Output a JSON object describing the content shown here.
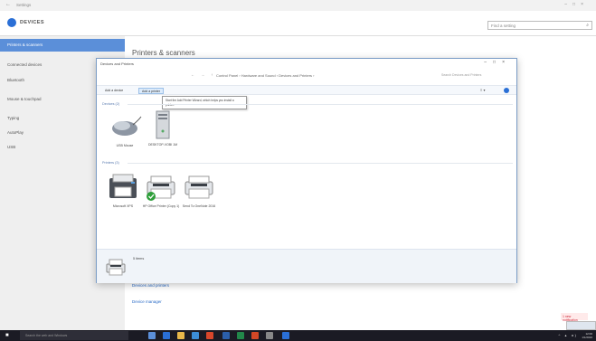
{
  "settings": {
    "window_title": "Settings",
    "window_controls": [
      "–",
      "□",
      "×"
    ],
    "header_title": "DEVICES",
    "search_placeholder": "Find a setting",
    "nav_items": [
      {
        "label": "Printers & scanners",
        "active": true
      },
      {
        "label": "Connected devices"
      },
      {
        "label": "Bluetooth"
      },
      {
        "label": "Mouse & touchpad"
      },
      {
        "label": "Typing"
      },
      {
        "label": "AutoPlay"
      },
      {
        "label": "USB"
      }
    ],
    "heading": "Printers & scanners",
    "links": [
      "Devices and printers",
      "Device manager"
    ],
    "notification_badge": "1 new notification"
  },
  "dp": {
    "title": "Devices and Printers",
    "controls": [
      "–",
      "□",
      "×"
    ],
    "nav_arrows": "← → ↑",
    "breadcrumb": "Control Panel › Hardware and Sound › Devices and Printers ›",
    "search_placeholder": "Search Devices and Printers",
    "toolbar": {
      "add_device": "Add a device",
      "add_printer": "Add a printer",
      "right_icons": "≡ ▾"
    },
    "tooltip": "Start the Add Printer Wizard, which helps you install a printer.",
    "groups": {
      "devices": "Devices (2)",
      "printers": "Printers (3)"
    },
    "devices": [
      {
        "name": "USB Mouse",
        "icon": "mouse-icon"
      },
      {
        "name": "DESKTOP-VOBI 1M",
        "icon": "computer-icon"
      }
    ],
    "printers": [
      {
        "name": "Microsoft XPS",
        "icon": "printer-icon"
      },
      {
        "name": "HP Office Printer (Copy 1)",
        "icon": "printer-icon",
        "default": true
      },
      {
        "name": "Send To OneNote 2016",
        "icon": "printer-icon"
      }
    ],
    "detail_count": "5 items"
  },
  "taskbar": {
    "search_placeholder": "Search the web and Windows",
    "clock_time": "12:00",
    "clock_date": "1/1/2016",
    "icons": [
      {
        "name": "task-view-icon",
        "color": "#5b8fd9"
      },
      {
        "name": "edge-icon",
        "color": "#2a6fd6"
      },
      {
        "name": "file-explorer-icon",
        "color": "#e8b84a"
      },
      {
        "name": "store-icon",
        "color": "#3c8dd6"
      },
      {
        "name": "mail-icon",
        "color": "#d9472b"
      },
      {
        "name": "word-icon",
        "color": "#2b5faa"
      },
      {
        "name": "excel-icon",
        "color": "#22874a"
      },
      {
        "name": "powerpoint-icon",
        "color": "#d24726"
      },
      {
        "name": "settings-icon",
        "color": "#888888"
      },
      {
        "name": "app-icon",
        "color": "#2a6fd6"
      }
    ]
  }
}
